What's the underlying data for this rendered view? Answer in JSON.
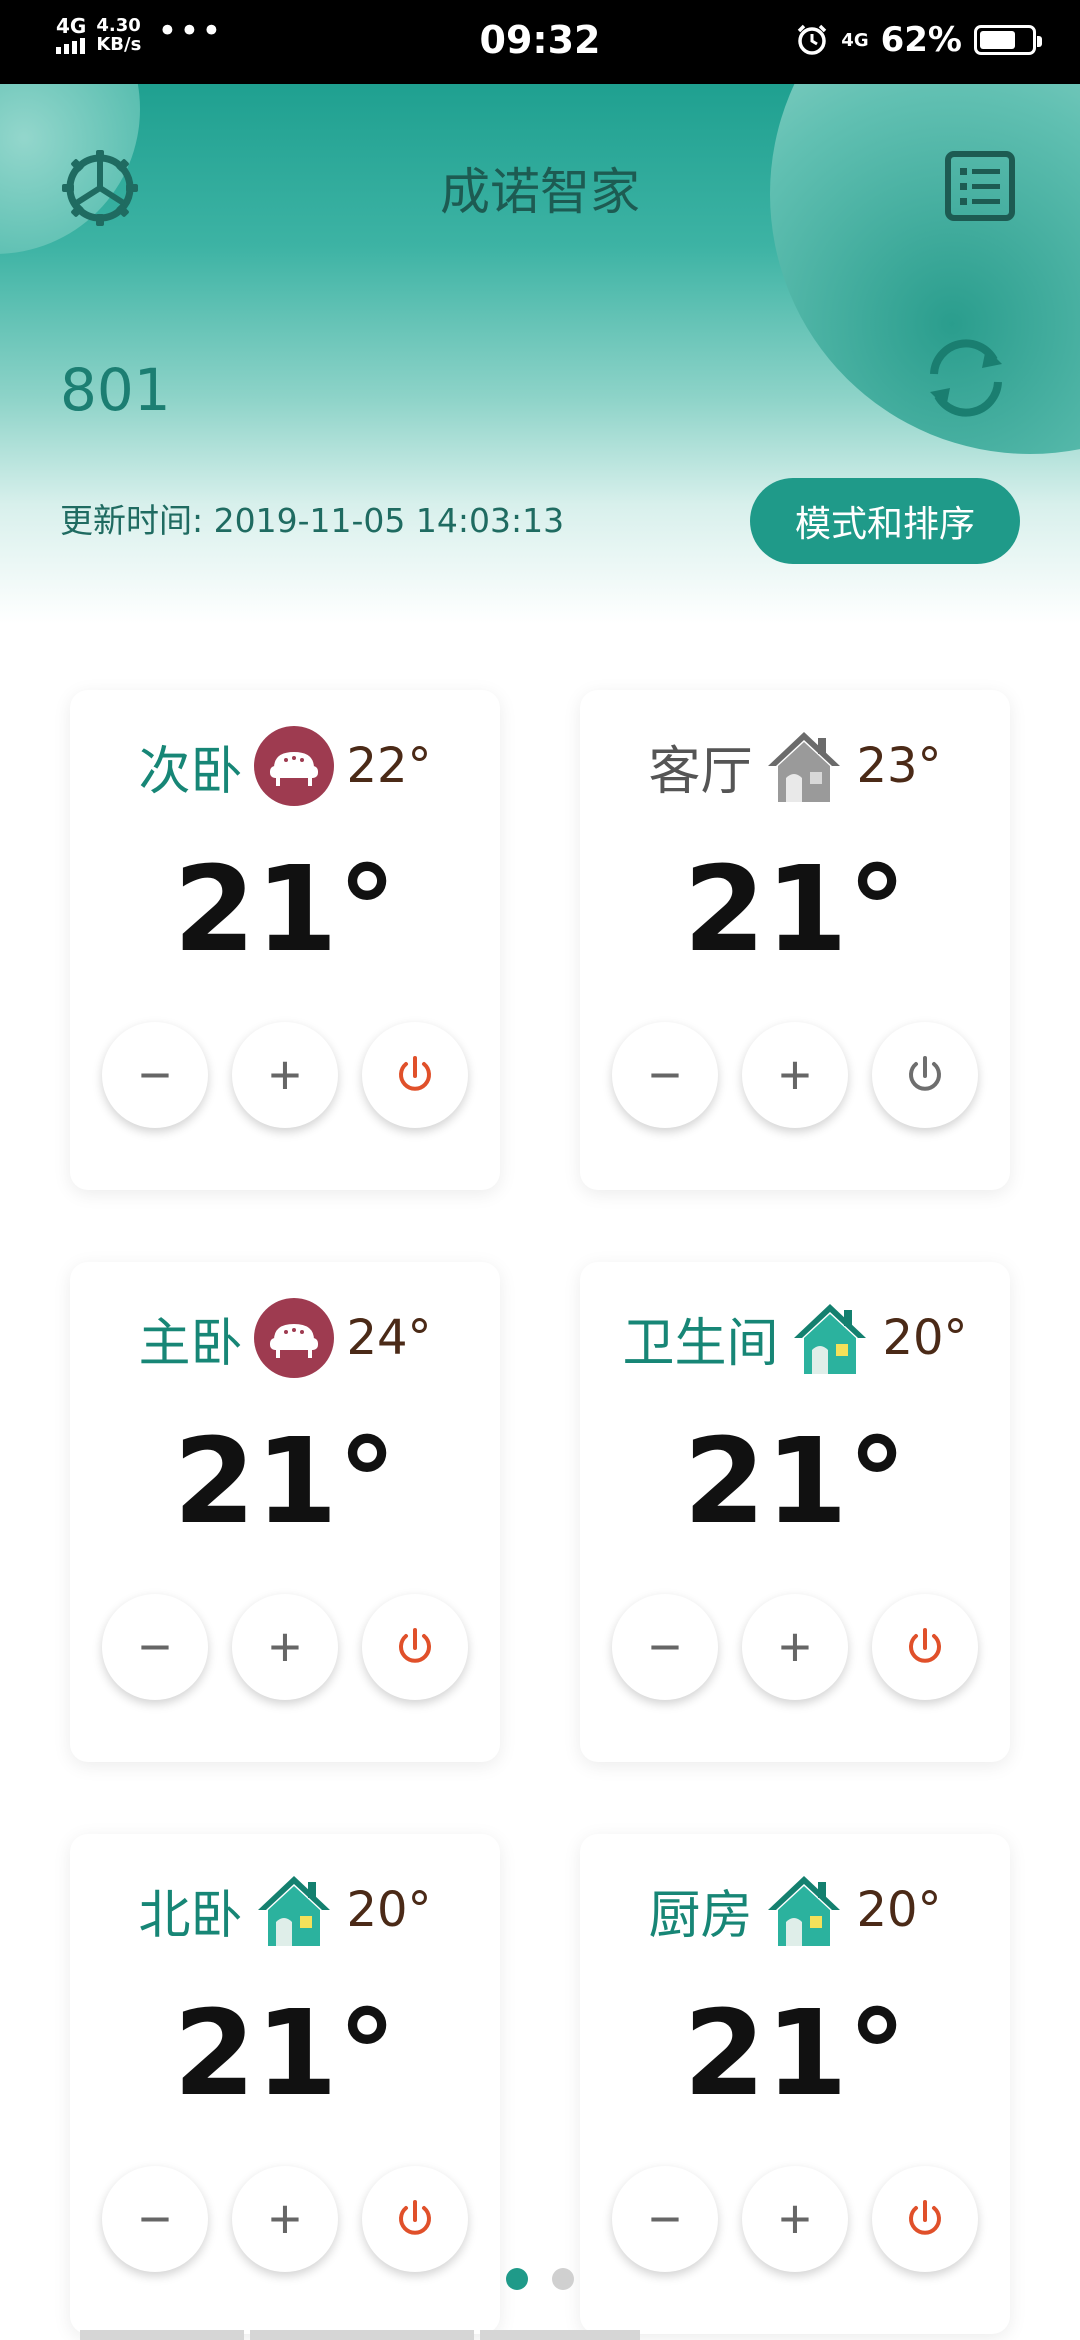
{
  "status_bar": {
    "network": "4G",
    "speed_value": "4.30",
    "speed_unit": "KB/s",
    "more": "•••",
    "time": "09:32",
    "network_right": "4G",
    "battery_percent": "62%",
    "battery_level": 0.62
  },
  "header": {
    "title": "成诺智家",
    "home_id": "801",
    "update_time": "更新时间: 2019-11-05 14:03:13",
    "mode_button": "模式和排序"
  },
  "rooms": [
    {
      "name": "次卧",
      "icon": "sofa-icon",
      "current_temp": "22°",
      "set_temp": "21°",
      "power": "on"
    },
    {
      "name": "客厅",
      "icon": "house-gray-icon",
      "current_temp": "23°",
      "set_temp": "21°",
      "power": "off"
    },
    {
      "name": "主卧",
      "icon": "sofa-icon",
      "current_temp": "24°",
      "set_temp": "21°",
      "power": "on"
    },
    {
      "name": "卫生间",
      "icon": "house-teal-icon",
      "current_temp": "20°",
      "set_temp": "21°",
      "power": "on"
    },
    {
      "name": "北卧",
      "icon": "house-teal-icon",
      "current_temp": "20°",
      "set_temp": "21°",
      "power": "on"
    },
    {
      "name": "厨房",
      "icon": "house-teal-icon",
      "current_temp": "20°",
      "set_temp": "21°",
      "power": "on"
    }
  ],
  "controls": {
    "minus": "−",
    "plus": "+"
  },
  "pager": {
    "pages": 2,
    "active": 1
  },
  "colors": {
    "accent": "#1f9a89",
    "room_name": "#178676",
    "power_on": "#e0502a",
    "power_off": "#6e6e6e",
    "pager_active": "#1f9a89",
    "pager_inactive": "#d0d0d0"
  }
}
